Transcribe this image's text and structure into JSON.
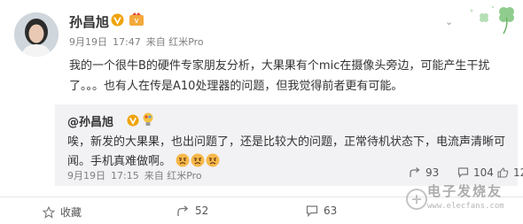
{
  "post": {
    "author": "孙昌旭",
    "date": "9月19日",
    "time": "17:47",
    "source": "来自 红米Pro",
    "text": "我的一个很牛B的硬件专家朋友分析，大果果有个mic在摄像头旁边，可能产生干扰了。。。也有人在传是A10处理器的问题，但我觉得前者更有可能。"
  },
  "repost": {
    "author": "@孙昌旭",
    "text": "唉，新发的大果果，也出问题了，还是比较大的问题，正常待机状态下，电流声清晰可闻。手机真难做啊。",
    "date": "9月19日",
    "time": "17:15",
    "source": "来自 红米Pro",
    "forwards": "93",
    "comments": "104",
    "likes": "127"
  },
  "footer": {
    "favorite_label": "收藏",
    "forward_count": "52",
    "comment_count": "63"
  },
  "watermark": {
    "brand": "电子发烧友",
    "url": "www.elecfans.com"
  },
  "colors": {
    "text": "#333333",
    "meta": "#808080",
    "repost_bg": "#f2f2f5",
    "verified": "#f0a30a"
  },
  "icons": [
    "verified-icon",
    "level-badge-icon",
    "chevron-down-icon",
    "clover-decoration",
    "bulb-icon",
    "angry-emoji-icon",
    "share-icon",
    "comment-icon",
    "like-icon",
    "star-icon"
  ]
}
